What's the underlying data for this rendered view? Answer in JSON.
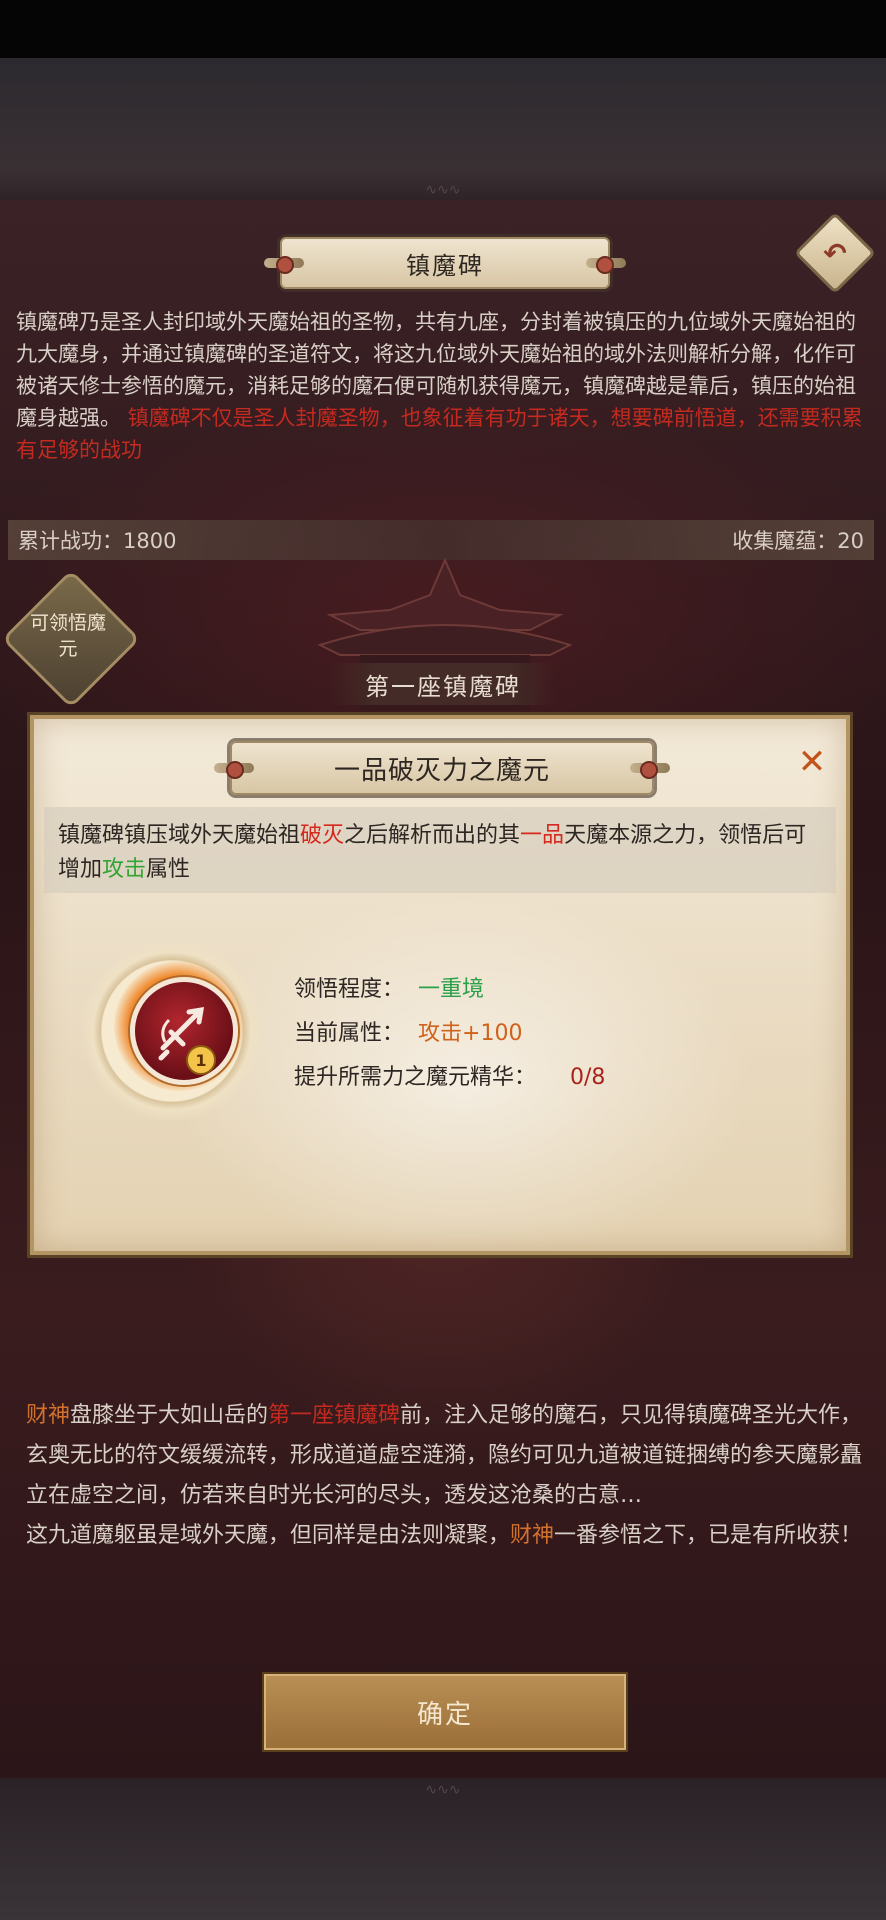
{
  "header": {
    "title": "镇魔碑",
    "back_icon": "back-arrow-icon"
  },
  "intro": {
    "paragraph": "镇魔碑乃是圣人封印域外天魔始祖的圣物，共有九座，分封着被镇压的九位域外天魔始祖的九大魔身，并通过镇魔碑的圣道符文，将这九位域外天魔始祖的域外法则解析分解，化作可被诸天修士参悟的魔元，消耗足够的魔石便可随机获得魔元，镇魔碑越是靠后，镇压的始祖魔身越强。",
    "warning": "镇魔碑不仅是圣人封魔圣物，也象征着有功于诸天，想要碑前悟道，还需要积累有足够的战功"
  },
  "stats": {
    "merit_label": "累计战功：",
    "merit_value": "1800",
    "collect_label": "收集魔蕴：",
    "collect_value": "20"
  },
  "enlight_badge": {
    "label": "可领悟魔元"
  },
  "stele": {
    "title": "第一座镇魔碑"
  },
  "dialog": {
    "title": "一品破灭力之魔元",
    "close_icon": "close-icon",
    "desc": {
      "p1": "镇魔碑镇压域外天魔始祖",
      "h1": "破灭",
      "p2": "之后解析而出的其",
      "h2": "一品",
      "p3": "天魔本源之力，领悟后可增加",
      "h3": "攻击",
      "p4": "属性"
    },
    "medal": {
      "level": "1",
      "icon": "sword-emblem-icon"
    },
    "attributes": [
      {
        "label": "领悟程度：",
        "value": "一重境",
        "color": "#2ba04a"
      },
      {
        "label": "当前属性：",
        "value": "攻击+100",
        "color": "#d0621b"
      },
      {
        "label": "提升所需力之魔元精华：",
        "value": "0/8",
        "color": "#a8231c"
      }
    ]
  },
  "story": {
    "s1": "财神",
    "s2": "盘膝坐于大如山岳的",
    "s3": "第一座镇魔碑",
    "s4": "前，注入足够的魔石，只见得镇魔碑圣光大作，玄奥无比的符文缓缓流转，形成道道虚空涟漪，隐约可见九道被道链捆缚的参天魔影矗立在虚空之间，仿若来自时光长河的尽头，透发这沧桑的古意…",
    "s5": "这九道魔躯虽是域外天魔，但同样是由法则凝聚，",
    "s6": "财神",
    "s7": "一番参悟之下，已是有所收获！"
  },
  "confirm_button": {
    "label": "确定"
  }
}
